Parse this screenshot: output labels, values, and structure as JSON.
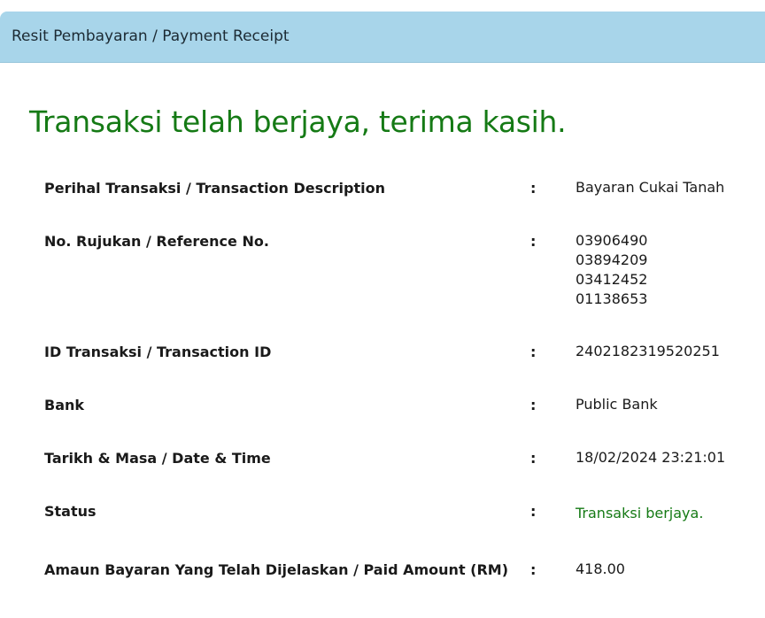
{
  "header": {
    "title": "Resit Pembayaran / Payment Receipt"
  },
  "main": {
    "headline": "Transaksi telah berjaya, terima kasih.",
    "separator": ":",
    "rows": [
      {
        "label": "Perihal Transaksi / Transaction Description",
        "value": "Bayaran Cukai Tanah"
      },
      {
        "label": "No. Rujukan / Reference No.",
        "values": [
          "03906490",
          "03894209",
          "03412452",
          "01138653"
        ]
      },
      {
        "label": "ID Transaksi / Transaction ID",
        "value": "2402182319520251"
      },
      {
        "label": "Bank",
        "value": "Public Bank"
      },
      {
        "label": "Tarikh & Masa / Date & Time",
        "value": "18/02/2024 23:21:01"
      },
      {
        "label": "Status",
        "value": "Transaksi berjaya."
      },
      {
        "label": "Amaun Bayaran Yang Telah Dijelaskan / Paid Amount (RM)",
        "value": "418.00"
      }
    ]
  },
  "colors": {
    "header_bg": "#a8d5ea",
    "success": "#157a15"
  }
}
